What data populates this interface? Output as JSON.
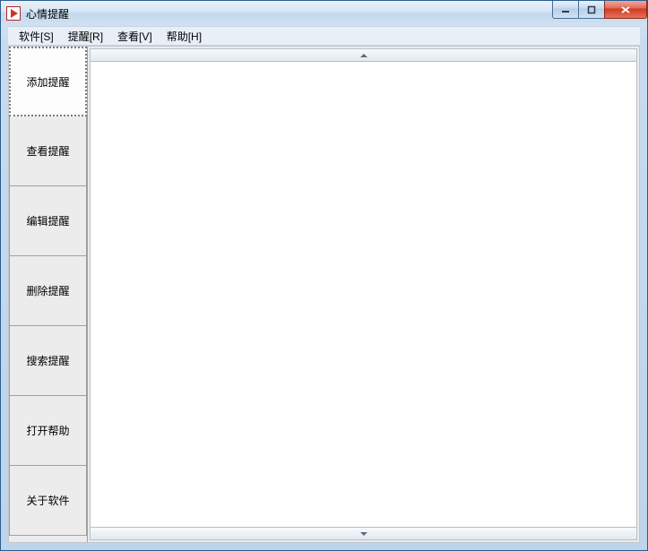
{
  "window": {
    "title": "心情提醒"
  },
  "menubar": {
    "items": [
      {
        "label": "软件[S]"
      },
      {
        "label": "提醒[R]"
      },
      {
        "label": "查看[V]"
      },
      {
        "label": "帮助[H]"
      }
    ]
  },
  "sidebar": {
    "items": [
      {
        "label": "添加提醒",
        "selected": true
      },
      {
        "label": "查看提醒",
        "selected": false
      },
      {
        "label": "编辑提醒",
        "selected": false
      },
      {
        "label": "删除提醒",
        "selected": false
      },
      {
        "label": "搜索提醒",
        "selected": false
      },
      {
        "label": "打开帮助",
        "selected": false
      },
      {
        "label": "关于软件",
        "selected": false
      }
    ]
  },
  "icons": {
    "app": "app-icon",
    "minimize": "minimize-icon",
    "maximize": "maximize-icon",
    "close": "close-icon",
    "scroll_up": "chevron-up-icon",
    "scroll_down": "chevron-down-icon"
  }
}
